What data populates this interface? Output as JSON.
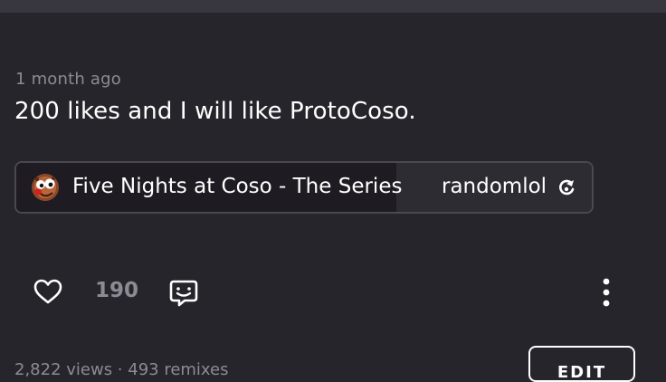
{
  "post": {
    "timestamp": "1 month ago",
    "text": "200 likes and I will like ProtoCoso."
  },
  "project_card": {
    "title": "Five Nights at Coso - The Series",
    "author": "randomlol",
    "thumb_icon": "cartoon-face-icon",
    "remix_icon": "remix-icon"
  },
  "actions": {
    "like_icon": "heart-icon",
    "like_count": "190",
    "comment_icon": "comment-icon",
    "more_icon": "more-vertical-icon"
  },
  "footer": {
    "stats_text": "2,822 views · 493 remixes",
    "edit_label": "EDIT"
  },
  "colors": {
    "background": "#27252c",
    "muted_text": "#8c8a93",
    "card_border": "#4a4850"
  }
}
